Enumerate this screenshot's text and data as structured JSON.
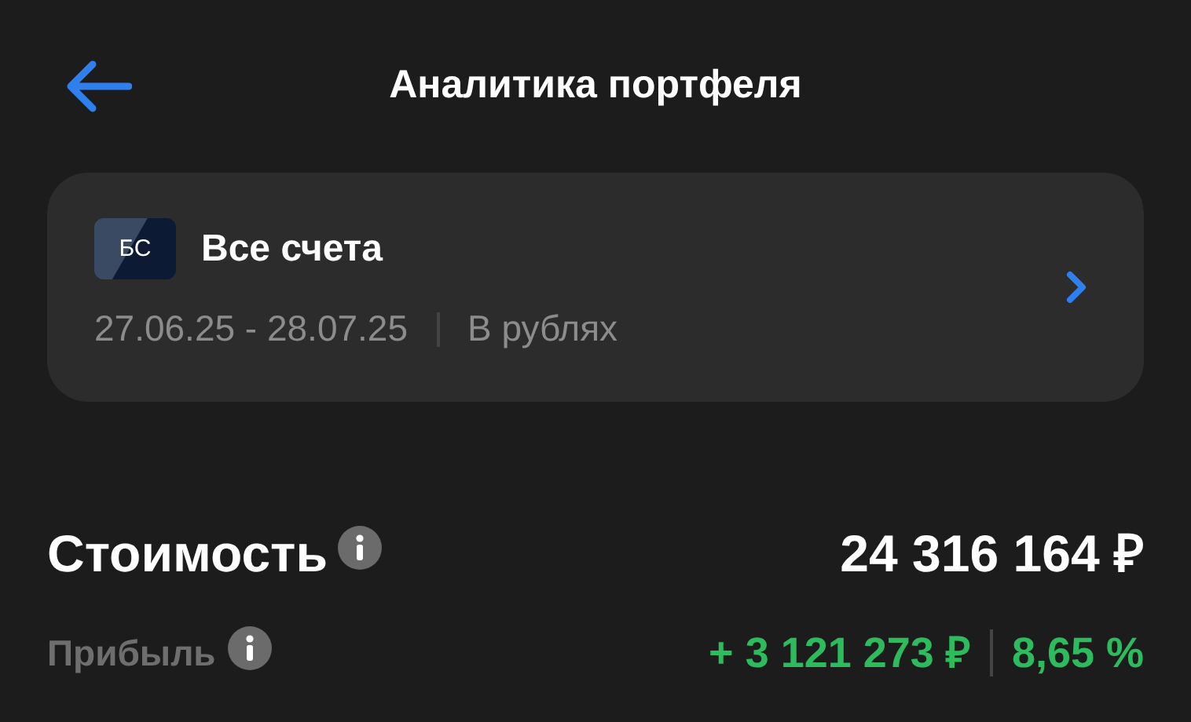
{
  "header": {
    "title": "Аналитика портфеля"
  },
  "account_card": {
    "logo": "БС",
    "name": "Все счета",
    "period": "27.06.25 - 28.07.25",
    "currency": "В рублях"
  },
  "summary": {
    "value_label": "Стоимость",
    "value": "24 316 164 ₽",
    "profit_label": "Прибыль",
    "profit_amount": "+ 3 121 273 ₽",
    "profit_percent": "8,65 %"
  }
}
